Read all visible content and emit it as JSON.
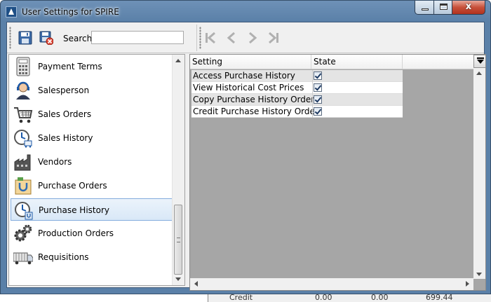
{
  "window": {
    "title": "User Settings for SPIRE",
    "close_glyph": "x"
  },
  "toolbar": {
    "save_icon": "save-icon",
    "discard_icon": "discard-icon",
    "search_label": "Search",
    "search_value": "",
    "nav_icons": [
      "first-record-icon",
      "previous-record-icon",
      "next-record-icon",
      "last-record-icon"
    ]
  },
  "sidebar": {
    "items": [
      {
        "label": "Payment Terms",
        "icon": "calculator-icon",
        "selected": false
      },
      {
        "label": "Salesperson",
        "icon": "headset-person-icon",
        "selected": false
      },
      {
        "label": "Sales Orders",
        "icon": "shopping-cart-icon",
        "selected": false
      },
      {
        "label": "Sales History",
        "icon": "clock-cart-icon",
        "selected": false
      },
      {
        "label": "Vendors",
        "icon": "factory-icon",
        "selected": false
      },
      {
        "label": "Purchase Orders",
        "icon": "purchase-bag-icon",
        "selected": false
      },
      {
        "label": "Purchase History",
        "icon": "clock-bag-icon",
        "selected": true
      },
      {
        "label": "Production Orders",
        "icon": "gears-icon",
        "selected": false
      },
      {
        "label": "Requisitions",
        "icon": "truck-icon",
        "selected": false
      }
    ]
  },
  "grid": {
    "columns": [
      "Setting",
      "State"
    ],
    "rows": [
      {
        "setting": "Access Purchase History",
        "state": true
      },
      {
        "setting": "View Historical Cost Prices",
        "state": true
      },
      {
        "setting": "Copy Purchase History Order",
        "state": true
      },
      {
        "setting": "Credit Purchase History Order",
        "state": true
      }
    ]
  },
  "background_peek": {
    "label": "Credit",
    "value1": "0.00",
    "value2": "0.00",
    "value3": "699.44"
  },
  "colors": {
    "titlebar": "#6e91b7",
    "selection": "#d9e8f7",
    "grid_background": "#a6a6a6",
    "close_button": "#c7503a"
  }
}
